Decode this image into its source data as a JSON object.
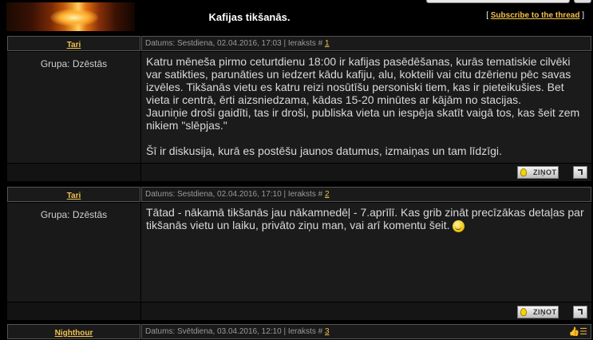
{
  "header": {
    "thread_title": "Kafijas tikšanās.",
    "subscribe_link": "Subscribe to the thread",
    "subscribe_open": "[",
    "subscribe_close": "]"
  },
  "posts": [
    {
      "author": "Tari",
      "group": "Grupa: Dzēstās",
      "meta_prefix": "Datums: Sestdiena, 02.04.2016, 17:03 | Ieraksts #",
      "post_number": "1",
      "lines": [
        "Katru mēneša pirmo ceturtdienu 18:00 ir kafijas pasēdēšanas, kurās tematiskie cilvēki",
        "var satikties, parunāties un iedzert kādu kafiju, alu, kokteili vai citu dzērienu pēc savas",
        "izvēles. Tikšanās vietu es katru reizi nosūtīšu personiski tiem, kas ir pieteikušies. Bet",
        "vieta ir centrā, ērti aizsniedzama, kādas 15-20 minūtes ar kājām no stacijas.",
        "Jauniņie droši gaidīti, tas ir droši, publiska vieta un iespēja skatīt vaigā tos, kas šeit zem",
        "nikiem \"slēpjas.\"",
        "",
        "Šī ir diskusija, kurā es postēšu jaunos datumus, izmaiņas un tam līdzīgi."
      ],
      "report_button": "ZIŅOT"
    },
    {
      "author": "Tari",
      "group": "Grupa: Dzēstās",
      "meta_prefix": "Datums: Sestdiena, 02.04.2016, 17:10 | Ieraksts #",
      "post_number": "2",
      "lines": [
        "Tātad - nākamā tikšanās jau nākamnedēļ - 7.aprīlī. Kas grib zināt precīzākas detaļas par",
        "tikšanās vietu un laiku, privāto ziņu man, vai arī komentu šeit."
      ],
      "report_button": "ZIŅOT"
    },
    {
      "author": "Nighthour",
      "meta_prefix": "Datums: Svētdiena, 03.04.2016, 12:10 | Ieraksts #",
      "post_number": "3"
    }
  ],
  "icons": {
    "report": "bulb-icon",
    "top": "arrow-up-icon",
    "smiley": "smiley-icon",
    "thumbs": "thumbs-up-icon"
  }
}
